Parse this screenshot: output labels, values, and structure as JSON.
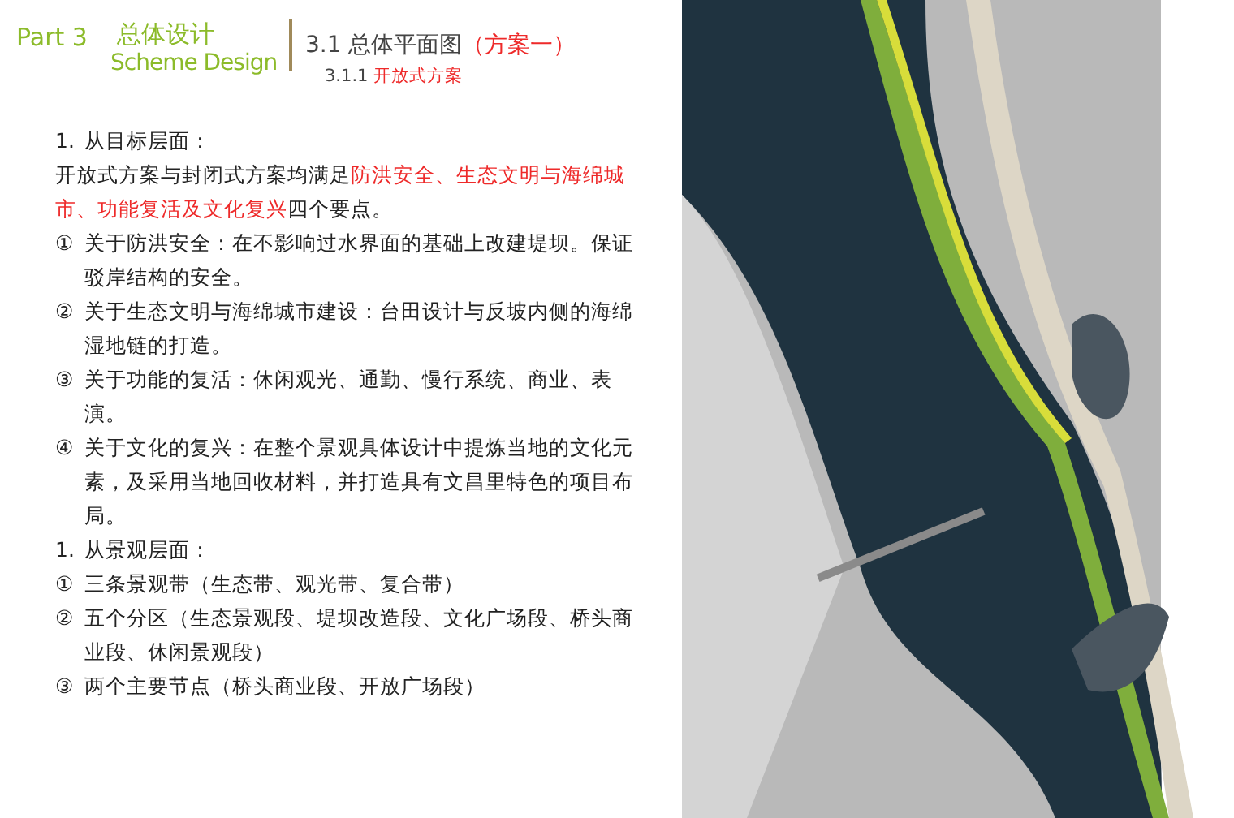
{
  "header": {
    "part": "Part 3",
    "title_cn": "总体设计",
    "title_en": "Scheme Design",
    "section_title": "3.1 总体平面图",
    "section_highlight": "（方案一）",
    "subsection_number": "3.1.1",
    "subsection_title": "开放式方案"
  },
  "items": [
    {
      "kind": "heading",
      "marker": "1.",
      "text": "从目标层面："
    },
    {
      "kind": "paragraph",
      "segments": [
        {
          "text": "开放式方案与封闭式方案均满足",
          "emphasis": false
        },
        {
          "text": "防洪安全、生态文明与海绵城市、功能复活及文化复兴",
          "emphasis": true
        },
        {
          "text": "四个要点。",
          "emphasis": false
        }
      ]
    },
    {
      "kind": "point",
      "marker": "①",
      "text": "关于防洪安全：在不影响过水界面的基础上改建堤坝。保证驳岸结构的安全。"
    },
    {
      "kind": "point",
      "marker": "②",
      "text": "关于生态文明与海绵城市建设：台田设计与反坡内侧的海绵湿地链的打造。"
    },
    {
      "kind": "point",
      "marker": "③",
      "text": "关于功能的复活：休闲观光、通勤、慢行系统、商业、表演。"
    },
    {
      "kind": "point",
      "marker": "④",
      "text": "关于文化的复兴：在整个景观具体设计中提炼当地的文化元素，及采用当地回收材料，并打造具有文昌里特色的项目布局。"
    },
    {
      "kind": "heading",
      "marker": "1.",
      "text": "从景观层面："
    },
    {
      "kind": "point",
      "marker": "①",
      "text": "三条景观带（生态带、观光带、复合带）"
    },
    {
      "kind": "point",
      "marker": "②",
      "text": "五个分区（生态景观段、堤坝改造段、文化广场段、桥头商业段、休闲景观段）"
    },
    {
      "kind": "point",
      "marker": "③",
      "text": "两个主要节点（桥头商业段、开放广场段）"
    }
  ]
}
